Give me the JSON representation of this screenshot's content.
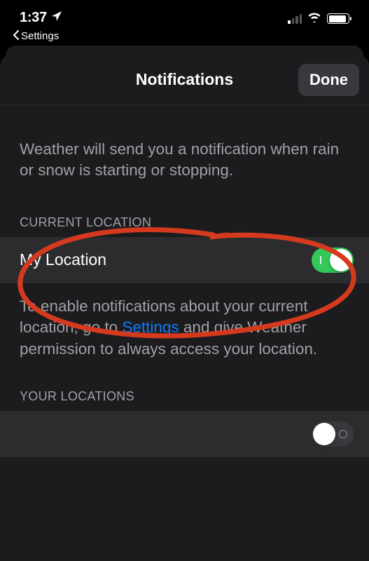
{
  "status": {
    "time": "1:37",
    "back_label": "Settings"
  },
  "sheet": {
    "title": "Notifications",
    "done": "Done"
  },
  "intro": "Weather will send you a notification when rain or snow is starting or stopping.",
  "current_location": {
    "header": "CURRENT LOCATION",
    "row_label": "My Location"
  },
  "footer": {
    "part1": "To enable notifications about your current location, go to ",
    "link": "Settings",
    "part2": " and give Weather permission to always access your location."
  },
  "your_locations": {
    "header": "YOUR LOCATIONS"
  }
}
